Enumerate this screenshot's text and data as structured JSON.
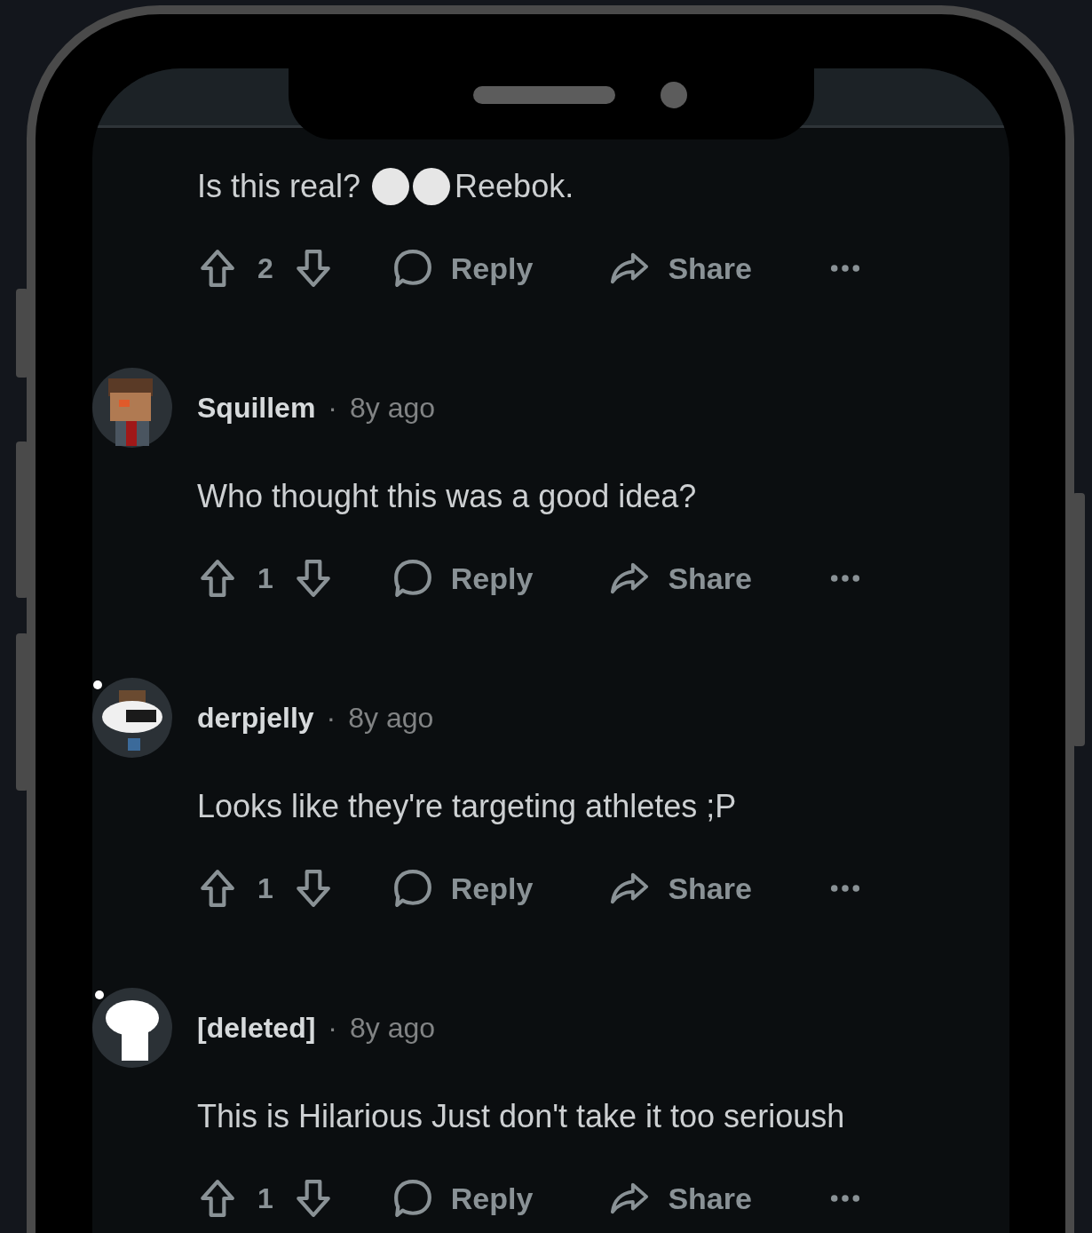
{
  "comments": [
    {
      "body_parts": [
        "Is this real?",
        "Reebok."
      ],
      "votes": "2",
      "reply": "Reply",
      "share": "Share"
    },
    {
      "author": "Squillem",
      "separator": "·",
      "time": "8y ago",
      "avatar": {
        "kind": "person"
      },
      "body_parts": [
        "Who thought this was a good idea?"
      ],
      "votes": "1",
      "reply": "Reply",
      "share": "Share"
    },
    {
      "author": "derpjelly",
      "separator": "·",
      "time": "8y ago",
      "avatar": {
        "kind": "goggles"
      },
      "body_parts": [
        "Looks like they're targeting athletes ;P"
      ],
      "votes": "1",
      "reply": "Reply",
      "share": "Share"
    },
    {
      "author": "[deleted]",
      "separator": "·",
      "time": "8y ago",
      "avatar": {
        "kind": "blank"
      },
      "body_parts": [
        "This is Hilarious Just don't take it too serioush"
      ],
      "votes": "1",
      "reply": "Reply",
      "share": "Share"
    }
  ]
}
